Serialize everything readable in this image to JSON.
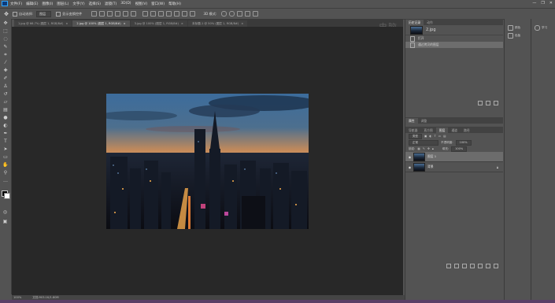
{
  "app": {
    "menus": [
      "文件(F)",
      "编辑(E)",
      "图像(I)",
      "图层(L)",
      "文字(Y)",
      "选择(S)",
      "滤镜(T)",
      "3D(D)",
      "视图(V)",
      "窗口(W)",
      "帮助(H)"
    ],
    "window_controls": [
      "—",
      "❐",
      "✕"
    ]
  },
  "options_bar": {
    "auto_select_label": "自动选择:",
    "auto_select_value": "图层",
    "transform_controls_label": "显示变换控件",
    "mode_3d_label": "3D 模式:"
  },
  "document_tabs": [
    {
      "label": "1.jpg @ 66.7% (图层 1, RGB/8#)",
      "active": false
    },
    {
      "label": "2.jpg @ 100% (图层 1, RGB/8#)",
      "active": true
    },
    {
      "label": "3.jpg @ 100% (图层 1, RGB/8#)",
      "active": false
    },
    {
      "label": "未标题-1 @ 50% (图层 1, RGB/8#)",
      "active": false
    }
  ],
  "watermark": "电脑",
  "status": {
    "zoom": "100%",
    "doc_size": "文档:903.1K/1.80M"
  },
  "history_panel": {
    "tabs": [
      "历史记录",
      "动作"
    ],
    "snapshot_label": "2.jpg",
    "items": [
      {
        "label": "打开",
        "selected": false
      },
      {
        "label": "通过拷贝的图层",
        "selected": true
      }
    ]
  },
  "layers_panel": {
    "top_tabs": [
      "属性",
      "调整"
    ],
    "tabs": [
      "导航器",
      "直方图",
      "图层",
      "通道",
      "路径"
    ],
    "active_tab_index": 2,
    "kind_filter": "类型",
    "blend_mode": "正常",
    "opacity_label": "不透明度:",
    "opacity_value": "100%",
    "lock_label": "锁定:",
    "fill_label": "填充:",
    "fill_value": "100%",
    "layers": [
      {
        "name": "图层 1",
        "selected": true,
        "locked": false
      },
      {
        "name": "背景",
        "selected": false,
        "locked": true
      }
    ]
  },
  "mini_panels": [
    {
      "label": "颜色"
    },
    {
      "label": "色板"
    }
  ],
  "side_panels": [
    {
      "label": "学习"
    }
  ]
}
